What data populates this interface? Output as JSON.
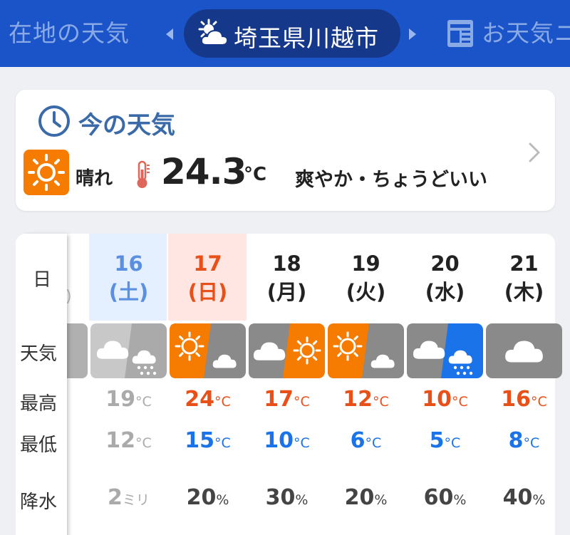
{
  "header": {
    "tab_left": "在地の天気",
    "city": "埼玉県川越市",
    "tab_right": "お天気ニ",
    "city_icon": "sun-behind-cloud-icon",
    "news_icon": "newspaper-icon"
  },
  "now": {
    "title": "今の天気",
    "condition": "晴れ",
    "temperature": "24.3",
    "unit": "°C",
    "feel": "爽やか・ちょうどいい",
    "condition_icon": "sun-icon"
  },
  "forecast": {
    "row_labels": {
      "date": "日",
      "weather": "天気",
      "high": "最高",
      "low": "最低",
      "precip": "降水"
    },
    "temp_unit": "°C",
    "percent_unit": "%",
    "days": [
      {
        "day": "16",
        "dow": "(土)",
        "icon": "cloud-then-rain-icon",
        "high": "19",
        "low": "12",
        "precip": "2",
        "precip_unit": "ミリ"
      },
      {
        "day": "17",
        "dow": "(日)",
        "icon": "sun-then-cloud-icon",
        "high": "24",
        "low": "15",
        "precip": "20",
        "precip_unit": "%"
      },
      {
        "day": "18",
        "dow": "(月)",
        "icon": "cloud-then-sun-icon",
        "high": "17",
        "low": "10",
        "precip": "30",
        "precip_unit": "%"
      },
      {
        "day": "19",
        "dow": "(火)",
        "icon": "sun-then-cloud-icon",
        "high": "12",
        "low": "6",
        "precip": "20",
        "precip_unit": "%"
      },
      {
        "day": "20",
        "dow": "(水)",
        "icon": "cloud-then-rain-icon",
        "high": "10",
        "low": "5",
        "precip": "60",
        "precip_unit": "%"
      },
      {
        "day": "21",
        "dow": "(木)",
        "icon": "cloud-icon",
        "high": "16",
        "low": "8",
        "precip": "40",
        "precip_unit": "%"
      }
    ]
  },
  "colors": {
    "header_bg": "#1b53c8",
    "pill_bg": "#16388a",
    "sun_orange": "#f57c00",
    "high_red": "#e8501a",
    "low_blue": "#1a73e8",
    "saturday_blue": "#5b8fe0",
    "sunday_red": "#e8501a",
    "past_gray": "#aaaaaa"
  }
}
